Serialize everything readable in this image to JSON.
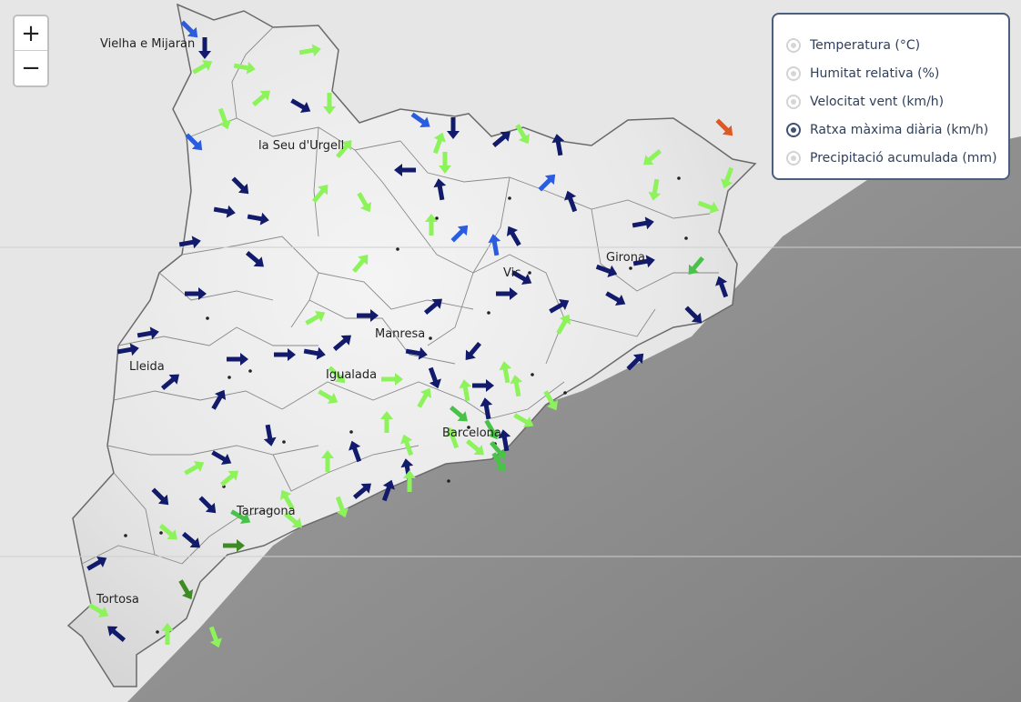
{
  "zoom": {
    "in_label": "+",
    "out_label": "−"
  },
  "legend": {
    "items": [
      {
        "label": "Temperatura (°C)",
        "selected": false
      },
      {
        "label": "Humitat relativa (%)",
        "selected": false
      },
      {
        "label": "Velocitat vent (km/h)",
        "selected": false
      },
      {
        "label": "Ratxa màxima diària (km/h)",
        "selected": true
      },
      {
        "label": "Precipitació acumulada (mm)",
        "selected": false
      }
    ]
  },
  "cities": [
    {
      "name": "Vielha e Mijaran"
    },
    {
      "name": "la Seu d'Urgell"
    },
    {
      "name": "Girona"
    },
    {
      "name": "Vic"
    },
    {
      "name": "Manresa"
    },
    {
      "name": "Lleida"
    },
    {
      "name": "Igualada"
    },
    {
      "name": "Barcelona"
    },
    {
      "name": "Tarragona"
    },
    {
      "name": "Tortosa"
    }
  ],
  "wind_colors": {
    "calm": "#111a6b",
    "light": "#2a5ce0",
    "moderate": "#8cf35a",
    "fresh": "#4ac24a",
    "strong": "#3e8b25",
    "very_strong": "#e2561f"
  }
}
